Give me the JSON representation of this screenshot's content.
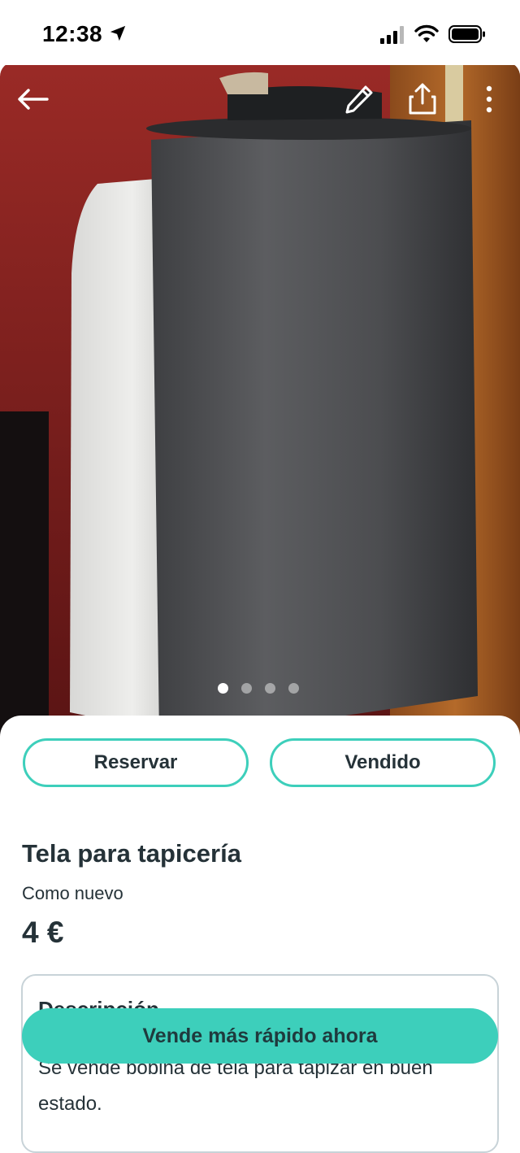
{
  "status_bar": {
    "time": "12:38",
    "icons": [
      "location-arrow-icon",
      "signal-icon",
      "wifi-icon",
      "battery-icon"
    ]
  },
  "photo": {
    "icons": [
      "back-arrow-icon",
      "pencil-icon",
      "share-icon",
      "more-vertical-icon"
    ],
    "carousel": {
      "count": 4,
      "active_index": 1
    }
  },
  "actions": {
    "reserve_label": "Reservar",
    "sold_label": "Vendido"
  },
  "item": {
    "title": "Tela para tapicería",
    "condition": "Como nuevo",
    "price": "4 €"
  },
  "description": {
    "heading": "Descripción",
    "text": "Se vende bobina de tela para tapizar en buen estado."
  },
  "cta_label": "Vende más rápido ahora",
  "colors": {
    "accent": "#3dcfbb",
    "text": "#253238",
    "border": "#c8d3d8"
  }
}
